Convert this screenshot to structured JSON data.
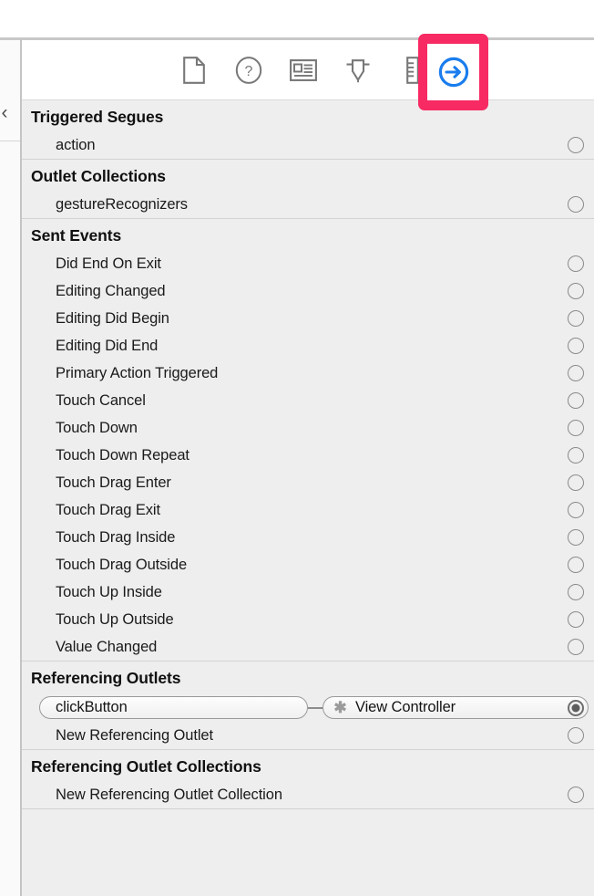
{
  "window": {
    "left_nav_icon": "chevron-left-icon"
  },
  "toolbar": {
    "accent_selection_color": "#f72a63",
    "icon_color": "#787878",
    "selected_icon_color": "#1a7ded",
    "items": [
      {
        "name": "file-inspector-icon",
        "label": "File Inspector",
        "selected": false
      },
      {
        "name": "quick-help-icon",
        "label": "Quick Help Inspector",
        "selected": false
      },
      {
        "name": "identity-inspector-icon",
        "label": "Identity Inspector",
        "selected": false
      },
      {
        "name": "attributes-inspector-icon",
        "label": "Attributes Inspector",
        "selected": false
      },
      {
        "name": "size-inspector-icon",
        "label": "Size Inspector",
        "selected": false
      },
      {
        "name": "connections-inspector-icon",
        "label": "Connections Inspector",
        "selected": true
      }
    ]
  },
  "inspector": {
    "sections": [
      {
        "title": "Triggered Segues",
        "rows": [
          {
            "label": "action",
            "connected": false
          }
        ]
      },
      {
        "title": "Outlet Collections",
        "rows": [
          {
            "label": "gestureRecognizers",
            "connected": false
          }
        ]
      },
      {
        "title": "Sent Events",
        "rows": [
          {
            "label": "Did End On Exit",
            "connected": false
          },
          {
            "label": "Editing Changed",
            "connected": false
          },
          {
            "label": "Editing Did Begin",
            "connected": false
          },
          {
            "label": "Editing Did End",
            "connected": false
          },
          {
            "label": "Primary Action Triggered",
            "connected": false
          },
          {
            "label": "Touch Cancel",
            "connected": false
          },
          {
            "label": "Touch Down",
            "connected": false
          },
          {
            "label": "Touch Down Repeat",
            "connected": false
          },
          {
            "label": "Touch Drag Enter",
            "connected": false
          },
          {
            "label": "Touch Drag Exit",
            "connected": false
          },
          {
            "label": "Touch Drag Inside",
            "connected": false
          },
          {
            "label": "Touch Drag Outside",
            "connected": false
          },
          {
            "label": "Touch Up Inside",
            "connected": false
          },
          {
            "label": "Touch Up Outside",
            "connected": false
          },
          {
            "label": "Value Changed",
            "connected": false
          }
        ]
      },
      {
        "title": "Referencing Outlets",
        "outlet_connection": {
          "outlet_name": "clickButton",
          "target_name": "View Controller",
          "target_badge_icon": "x-mark-icon",
          "connected": true
        },
        "rows": [
          {
            "label": "New Referencing Outlet",
            "connected": false
          }
        ]
      },
      {
        "title": "Referencing Outlet Collections",
        "rows": [
          {
            "label": "New Referencing Outlet Collection",
            "connected": false
          }
        ]
      }
    ]
  }
}
